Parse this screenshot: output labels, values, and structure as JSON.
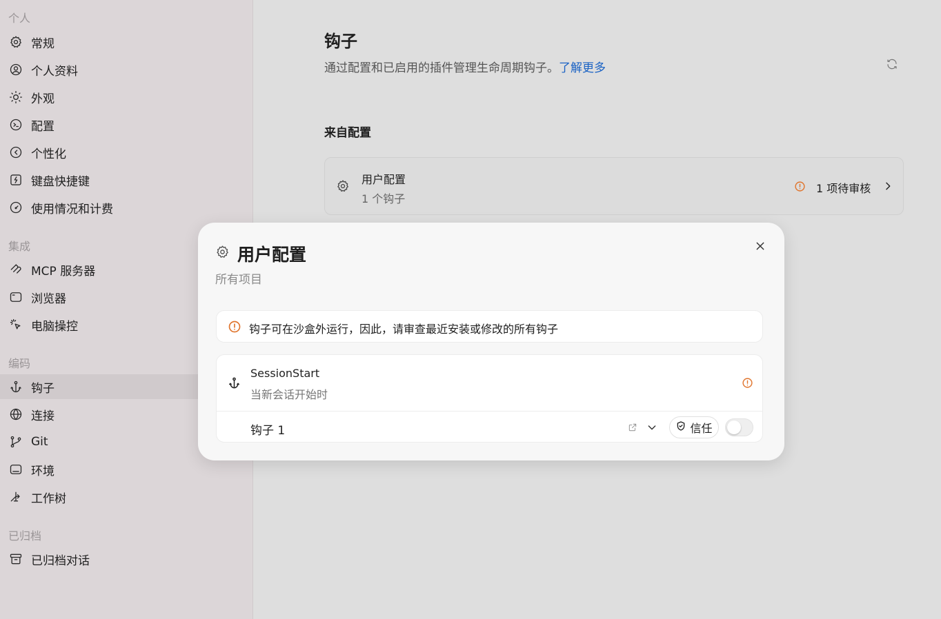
{
  "sidebar": {
    "sections": [
      {
        "label": "个人",
        "items": [
          {
            "label": "常规",
            "icon": "gear-icon"
          },
          {
            "label": "个人资料",
            "icon": "user-circle-icon"
          },
          {
            "label": "外观",
            "icon": "sun-icon"
          },
          {
            "label": "配置",
            "icon": "config-icon"
          },
          {
            "label": "个性化",
            "icon": "personalization-icon"
          },
          {
            "label": "键盘快捷键",
            "icon": "keyboard-icon"
          },
          {
            "label": "使用情况和计费",
            "icon": "gauge-icon"
          }
        ]
      },
      {
        "label": "集成",
        "items": [
          {
            "label": "MCP 服务器",
            "icon": "mcp-icon"
          },
          {
            "label": "浏览器",
            "icon": "browser-icon"
          },
          {
            "label": "电脑操控",
            "icon": "cursor-click-icon"
          }
        ]
      },
      {
        "label": "编码",
        "items": [
          {
            "label": "钩子",
            "icon": "anchor-icon"
          },
          {
            "label": "连接",
            "icon": "globe-icon"
          },
          {
            "label": "Git",
            "icon": "git-branch-icon"
          },
          {
            "label": "环境",
            "icon": "terminal-icon"
          },
          {
            "label": "工作树",
            "icon": "worktree-icon"
          }
        ]
      },
      {
        "label": "已归档",
        "items": [
          {
            "label": "已归档对话",
            "icon": "archive-icon"
          }
        ]
      }
    ],
    "active": "钩子"
  },
  "main": {
    "title": "钩子",
    "subtitle": "通过配置和已启用的插件管理生命周期钩子。",
    "learn_more": "了解更多",
    "section_heading": "来自配置",
    "config_card": {
      "title": "用户配置",
      "subtitle": "1 个钩子",
      "pending": "1 项待审核"
    }
  },
  "modal": {
    "title": "用户配置",
    "subtitle": "所有项目",
    "alert": "钩子可在沙盒外运行，因此，请审查最近安装或修改的所有钩子",
    "hook_event": {
      "name": "SessionStart",
      "description": "当新会话开始时"
    },
    "hook": {
      "label": "钩子 1",
      "trust_label": "信任",
      "enabled": false
    }
  },
  "colors": {
    "sidebar_bg": "#dcd6d8",
    "main_bg": "#dedede",
    "link": "#1a62c4",
    "warning": "#e0742c"
  }
}
